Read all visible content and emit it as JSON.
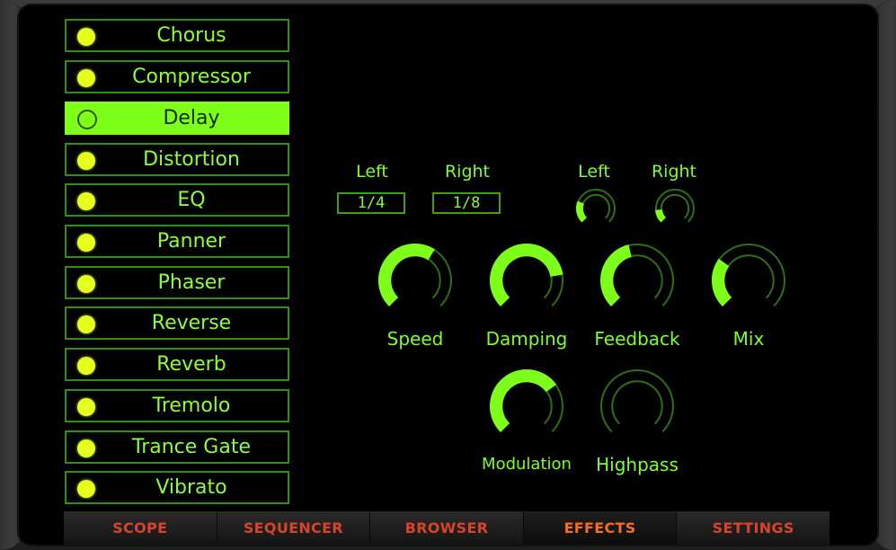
{
  "effects_list": [
    {
      "label": "Chorus",
      "active": false
    },
    {
      "label": "Compressor",
      "active": false
    },
    {
      "label": "Delay",
      "active": true
    },
    {
      "label": "Distortion",
      "active": false
    },
    {
      "label": "EQ",
      "active": false
    },
    {
      "label": "Panner",
      "active": false
    },
    {
      "label": "Phaser",
      "active": false
    },
    {
      "label": "Reverse",
      "active": false
    },
    {
      "label": "Reverb",
      "active": false
    },
    {
      "label": "Tremolo",
      "active": false
    },
    {
      "label": "Trance Gate",
      "active": false
    },
    {
      "label": "Vibrato",
      "active": false
    }
  ],
  "delay": {
    "rate_left_label": "Left",
    "rate_right_label": "Right",
    "rate_left_value": "1/4",
    "rate_right_value": "1/8",
    "pan_left_label": "Left",
    "pan_right_label": "Right",
    "pan_left_level": 0.25,
    "pan_right_level": 0.15,
    "knobs": {
      "speed": {
        "label": "Speed",
        "level": 0.62
      },
      "damping": {
        "label": "Damping",
        "level": 0.8
      },
      "feedback": {
        "label": "Feedback",
        "level": 0.45
      },
      "mix": {
        "label": "Mix",
        "level": 0.3
      },
      "modulation": {
        "label": "Modulation",
        "level": 0.7
      },
      "highpass": {
        "label": "Highpass",
        "level": 0.0
      }
    }
  },
  "tabs": [
    {
      "label": "SCOPE",
      "active": false
    },
    {
      "label": "SEQUENCER",
      "active": false
    },
    {
      "label": "BROWSER",
      "active": false
    },
    {
      "label": "EFFECTS",
      "active": true
    },
    {
      "label": "SETTINGS",
      "active": false
    }
  ],
  "colors": {
    "accent": "#7dff1a",
    "led": "#e6ff1e",
    "knob_track": "#2f6f14",
    "tab_text": "#d8432a",
    "tab_active_text": "#ff6a1e"
  }
}
